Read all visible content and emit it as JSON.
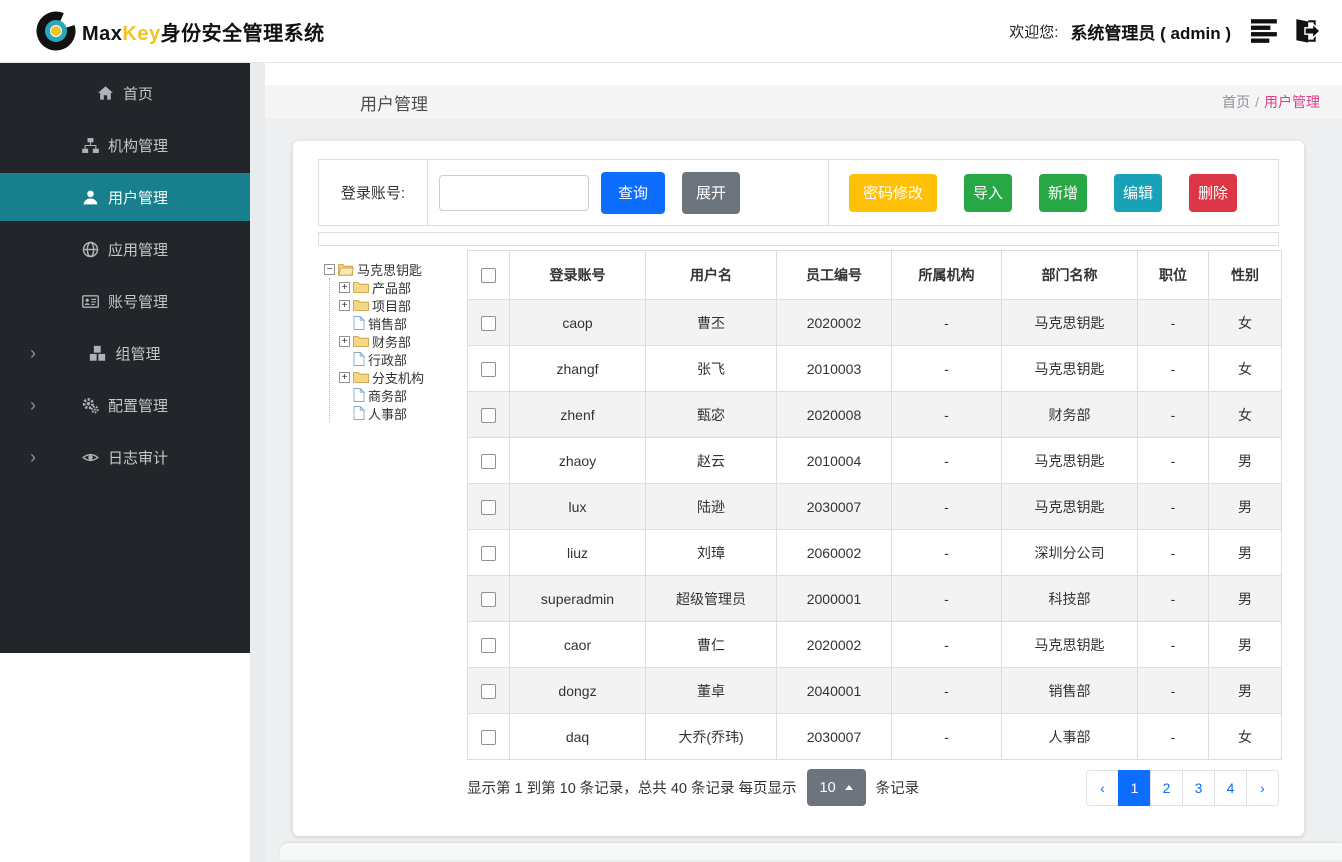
{
  "header": {
    "brand": {
      "max": "Max",
      "key": "Key",
      "suffix": "身份安全管理系统",
      "logo_icon": "maxkey-logo-icon"
    },
    "welcome_label": "欢迎您:",
    "user": "系统管理员 ( admin )",
    "action_icons": [
      "menu-icon",
      "logout-icon"
    ]
  },
  "sidebar": {
    "items": [
      {
        "name": "home",
        "icon": "home-icon",
        "label": "首页",
        "active": false,
        "expandable": false
      },
      {
        "name": "org",
        "icon": "sitemap-icon",
        "label": "机构管理",
        "active": false,
        "expandable": false
      },
      {
        "name": "user",
        "icon": "user-icon",
        "label": "用户管理",
        "active": true,
        "expandable": false
      },
      {
        "name": "app",
        "icon": "globe-icon",
        "label": "应用管理",
        "active": false,
        "expandable": false
      },
      {
        "name": "account",
        "icon": "id-card-icon",
        "label": "账号管理",
        "active": false,
        "expandable": false
      },
      {
        "name": "group",
        "icon": "cubes-icon",
        "label": "组管理",
        "active": false,
        "expandable": true
      },
      {
        "name": "config",
        "icon": "gears-icon",
        "label": "配置管理",
        "active": false,
        "expandable": true
      },
      {
        "name": "audit",
        "icon": "eye-icon",
        "label": "日志审计",
        "active": false,
        "expandable": true
      }
    ]
  },
  "page": {
    "title": "用户管理",
    "breadcrumb": {
      "root": "首页",
      "separator": "/",
      "current": "用户管理"
    }
  },
  "toolbar": {
    "search_label": "登录账号:",
    "search_value": "",
    "buttons": {
      "query": "查询",
      "expand": "展开",
      "password": "密码修改",
      "import": "导入",
      "add": "新增",
      "edit": "编辑",
      "delete": "删除"
    }
  },
  "tree": {
    "root": {
      "label": "马克思钥匙",
      "icon": "folder-open-icon",
      "expander": "minus-box-icon"
    },
    "children": [
      {
        "label": "产品部",
        "type": "branch",
        "icon": "folder-closed-icon",
        "expander": "plus-box-icon"
      },
      {
        "label": "项目部",
        "type": "branch",
        "icon": "folder-closed-icon",
        "expander": "plus-box-icon"
      },
      {
        "label": "销售部",
        "type": "leaf",
        "icon": "file-icon"
      },
      {
        "label": "财务部",
        "type": "branch",
        "icon": "folder-closed-icon",
        "expander": "plus-box-icon"
      },
      {
        "label": "行政部",
        "type": "leaf",
        "icon": "file-icon"
      },
      {
        "label": "分支机构",
        "type": "branch",
        "icon": "folder-closed-icon",
        "expander": "plus-box-icon"
      },
      {
        "label": "商务部",
        "type": "leaf",
        "icon": "file-icon"
      },
      {
        "label": "人事部",
        "type": "leaf",
        "icon": "file-icon"
      }
    ]
  },
  "table": {
    "columns": [
      "登录账号",
      "用户名",
      "员工编号",
      "所属机构",
      "部门名称",
      "职位",
      "性别"
    ],
    "rows": [
      [
        "caop",
        "曹丕",
        "2020002",
        "-",
        "马克思钥匙",
        "-",
        "女"
      ],
      [
        "zhangf",
        "张飞",
        "2010003",
        "-",
        "马克思钥匙",
        "-",
        "女"
      ],
      [
        "zhenf",
        "甄宓",
        "2020008",
        "-",
        "财务部",
        "-",
        "女"
      ],
      [
        "zhaoy",
        "赵云",
        "2010004",
        "-",
        "马克思钥匙",
        "-",
        "男"
      ],
      [
        "lux",
        "陆逊",
        "2030007",
        "-",
        "马克思钥匙",
        "-",
        "男"
      ],
      [
        "liuz",
        "刘璋",
        "2060002",
        "-",
        "深圳分公司",
        "-",
        "男"
      ],
      [
        "superadmin",
        "超级管理员",
        "2000001",
        "-",
        "科技部",
        "-",
        "男"
      ],
      [
        "caor",
        "曹仁",
        "2020002",
        "-",
        "马克思钥匙",
        "-",
        "男"
      ],
      [
        "dongz",
        "董卓",
        "2040001",
        "-",
        "销售部",
        "-",
        "男"
      ],
      [
        "daq",
        "大乔(乔玮)",
        "2030007",
        "-",
        "人事部",
        "-",
        "女"
      ]
    ]
  },
  "footer": {
    "summary_prefix": "显示第 1 到第 10 条记录，总共 40 条记录  每页显示",
    "page_size": "10",
    "page_size_caret": "caret-up-icon",
    "summary_suffix": "条记录",
    "pager": {
      "prev": "‹",
      "pages": [
        "1",
        "2",
        "3",
        "4"
      ],
      "next": "›",
      "active": "1"
    }
  },
  "colors": {
    "primary": "#0d6efd",
    "secondary": "#6c757d",
    "success": "#28a745",
    "info": "#17a2b8",
    "warning": "#ffc107",
    "danger": "#dc3545",
    "sidebar_active": "#17808c",
    "breadcrumb_active": "#e23c8c",
    "brand_yellow": "#f5c31d"
  }
}
